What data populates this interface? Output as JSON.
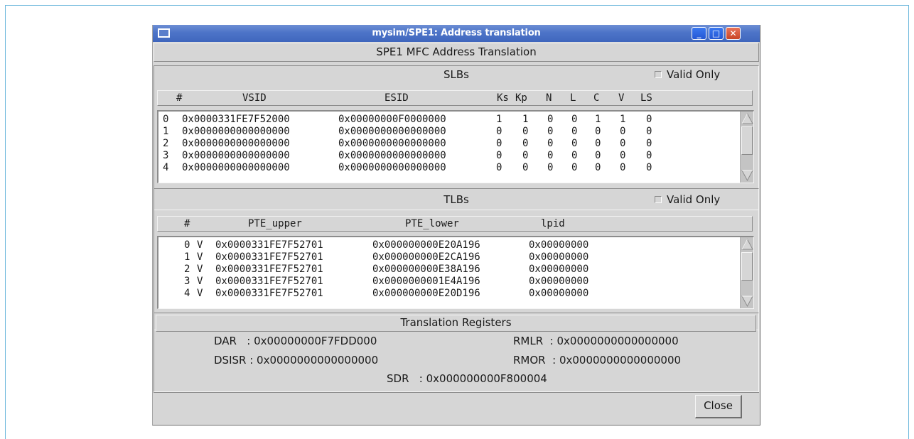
{
  "window": {
    "title": "mysim/SPE1: Address translation",
    "main_heading": "SPE1 MFC Address Translation",
    "minimize_glyph": "_",
    "maximize_glyph": "□",
    "close_glyph": "✕"
  },
  "slbs": {
    "heading": "SLBs",
    "valid_only_label": "Valid Only",
    "valid_only_checked": false,
    "columns": [
      "#",
      "VSID",
      "ESID",
      "Ks",
      "Kp",
      "N",
      "L",
      "C",
      "V",
      "LS"
    ],
    "rows": [
      [
        "0",
        "0x0000331FE7F52000",
        "0x00000000F0000000",
        "1",
        "1",
        "0",
        "0",
        "1",
        "1",
        "0"
      ],
      [
        "1",
        "0x0000000000000000",
        "0x0000000000000000",
        "0",
        "0",
        "0",
        "0",
        "0",
        "0",
        "0"
      ],
      [
        "2",
        "0x0000000000000000",
        "0x0000000000000000",
        "0",
        "0",
        "0",
        "0",
        "0",
        "0",
        "0"
      ],
      [
        "3",
        "0x0000000000000000",
        "0x0000000000000000",
        "0",
        "0",
        "0",
        "0",
        "0",
        "0",
        "0"
      ],
      [
        "4",
        "0x0000000000000000",
        "0x0000000000000000",
        "0",
        "0",
        "0",
        "0",
        "0",
        "0",
        "0"
      ]
    ]
  },
  "tlbs": {
    "heading": "TLBs",
    "valid_only_label": "Valid Only",
    "valid_only_checked": false,
    "columns": [
      "#",
      "PTE_upper",
      "PTE_lower",
      "lpid"
    ],
    "rows": [
      [
        "0",
        "V",
        "0x0000331FE7F52701",
        "0x000000000E20A196",
        "0x00000000"
      ],
      [
        "1",
        "V",
        "0x0000331FE7F52701",
        "0x000000000E2CA196",
        "0x00000000"
      ],
      [
        "2",
        "V",
        "0x0000331FE7F52701",
        "0x000000000E38A196",
        "0x00000000"
      ],
      [
        "3",
        "V",
        "0x0000331FE7F52701",
        "0x0000000001E4A196",
        "0x00000000"
      ],
      [
        "4",
        "V",
        "0x0000331FE7F52701",
        "0x000000000E20D196",
        "0x00000000"
      ]
    ]
  },
  "registers": {
    "heading": "Translation Registers",
    "dar": "DAR   : 0x00000000F7FDD000",
    "dsisr": "DSISR : 0x0000000000000000",
    "rmlr": "RMLR  : 0x0000000000000000",
    "rmor": "RMOR  : 0x0000000000000000",
    "sdr": "SDR   : 0x000000000F800004"
  },
  "footer": {
    "close_label": "Close"
  }
}
